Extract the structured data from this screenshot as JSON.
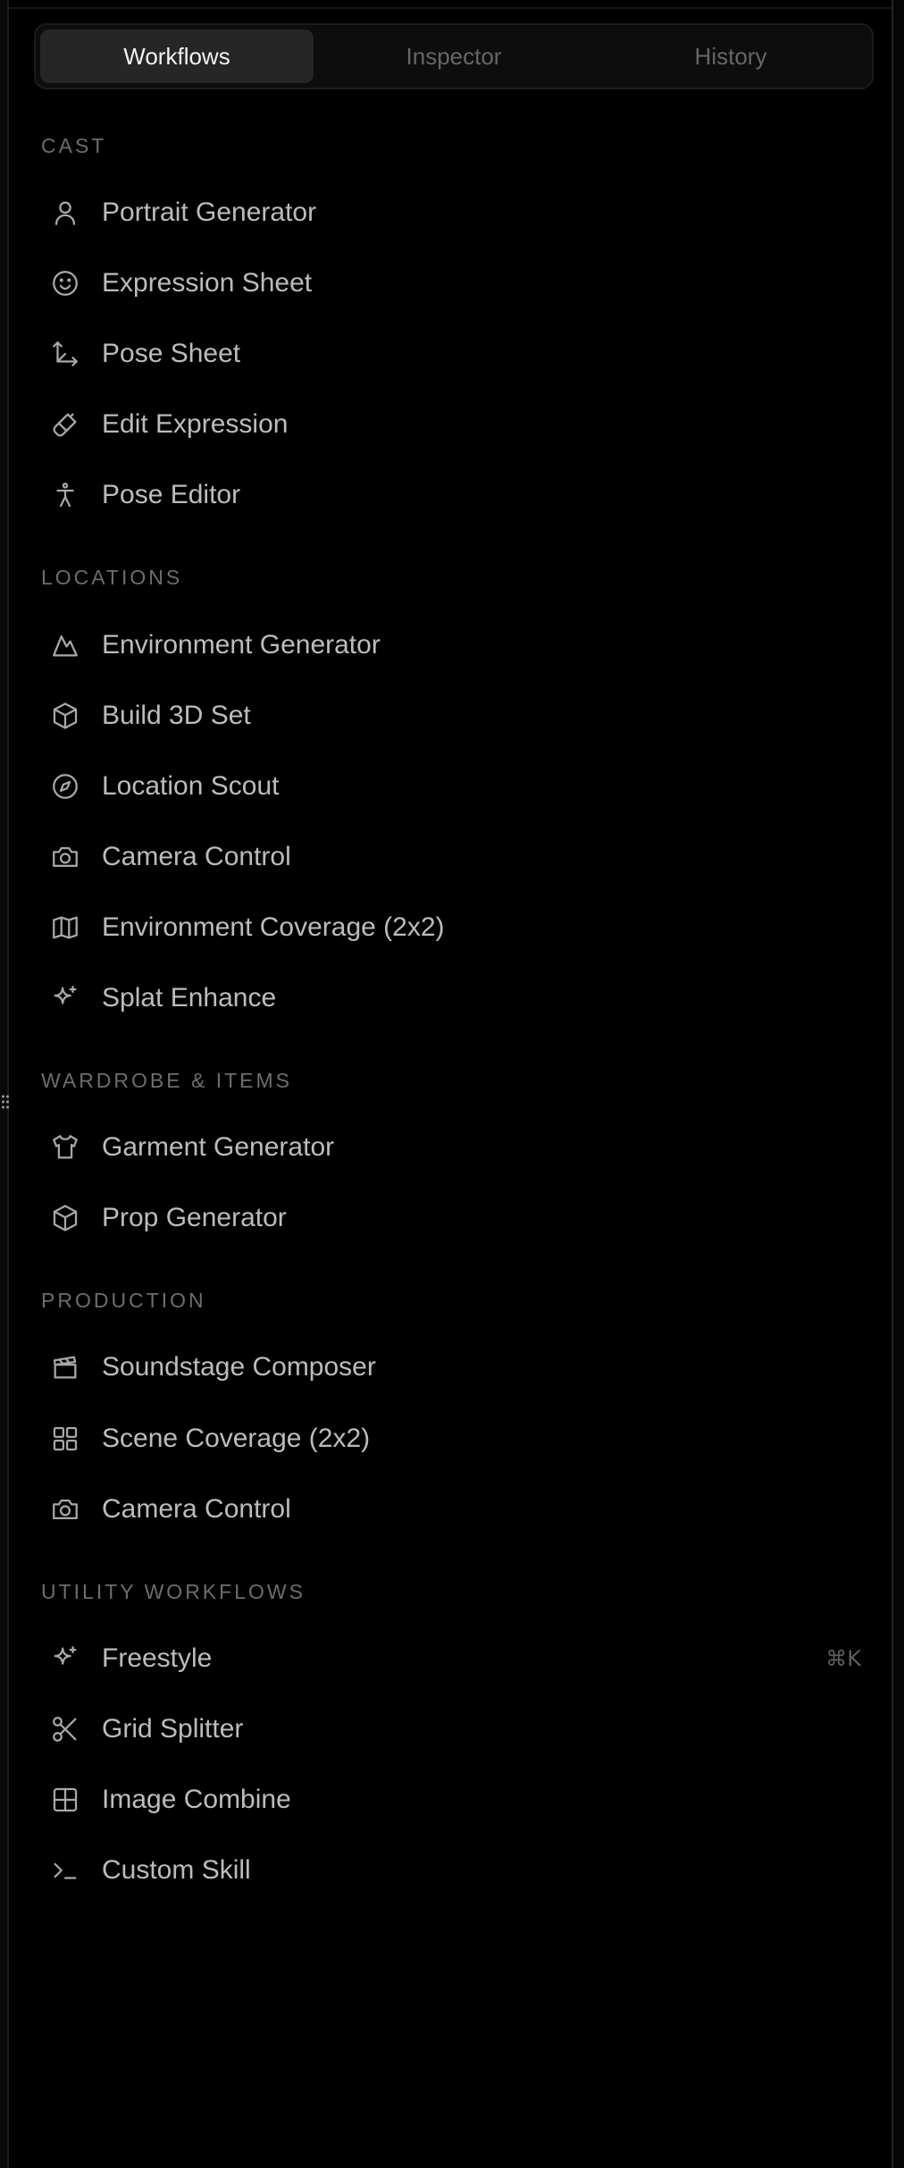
{
  "tabs": [
    {
      "label": "Workflows",
      "active": true
    },
    {
      "label": "Inspector",
      "active": false
    },
    {
      "label": "History",
      "active": false
    }
  ],
  "sections": {
    "cast": {
      "title": "CAST",
      "items": [
        "Portrait Generator",
        "Expression Sheet",
        "Pose Sheet",
        "Edit Expression",
        "Pose Editor"
      ]
    },
    "locations": {
      "title": "LOCATIONS",
      "items": [
        "Environment Generator",
        "Build 3D Set",
        "Location Scout",
        "Camera Control",
        "Environment Coverage (2x2)",
        "Splat Enhance"
      ]
    },
    "wardrobe": {
      "title": "WARDROBE & ITEMS",
      "items": [
        "Garment Generator",
        "Prop Generator"
      ]
    },
    "production": {
      "title": "PRODUCTION",
      "items": [
        "Soundstage Composer",
        "Scene Coverage (2x2)",
        "Camera Control"
      ]
    },
    "utility": {
      "title": "UTILITY WORKFLOWS",
      "items": [
        "Freestyle",
        "Grid Splitter",
        "Image Combine",
        "Custom Skill"
      ],
      "freestyle_shortcut": "⌘K"
    }
  },
  "colors": {
    "background": "#000000",
    "active_tab": "#262626",
    "section_header": "#6d6d6d",
    "item_text": "#bcbcbc"
  }
}
